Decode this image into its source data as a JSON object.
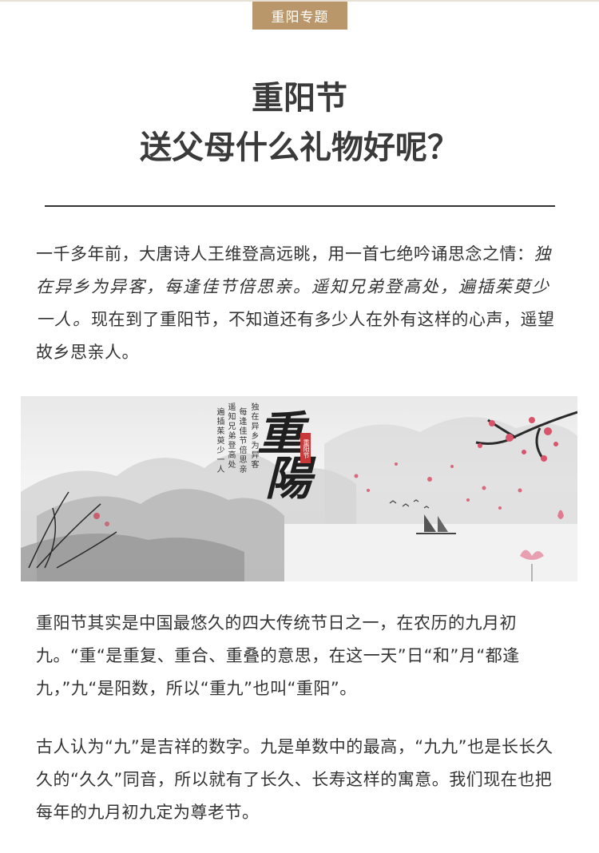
{
  "header": {
    "badge": "重阳专题"
  },
  "title": {
    "line1": "重阳节",
    "line2": "送父母什么礼物好呢？"
  },
  "intro": {
    "lead": "一千多年前，大唐诗人王维登高远眺，用一首七绝吟诵思念之情：",
    "poem": "独在异乡为异客，每逢佳节倍思亲。遥知兄弟登高处，遍插茱萸少一人。",
    "tail": "现在到了重阳节，不知道还有多少人在外有这样的心声，遥望故乡思亲人。"
  },
  "banner": {
    "calligraphy_1": "重",
    "calligraphy_2": "陽",
    "seal": "重阳节",
    "poem_columns": [
      "独在异乡为异客",
      "每逢佳节倍思亲",
      "遥知兄弟登高处",
      "遍插茱萸少一人"
    ]
  },
  "paragraphs": [
    "重阳节其实是中国最悠久的四大传统节日之一，在农历的九月初九。“重“是重复、重合、重叠的意思，在这一天”日“和”月“都逢九，”九“是阳数，所以“重九”也叫“重阳”。",
    "古人认为“九”是吉祥的数字。九是单数中的最高，“九九”也是长长久久的“久久”同音，所以就有了长久、长寿这样的寓意。我们现在也把每年的九月初九定为尊老节。"
  ],
  "colors": {
    "badge_bg": "#b9976a",
    "title": "#3a3a3a",
    "text": "#333333",
    "blossom": "#d9536a"
  }
}
